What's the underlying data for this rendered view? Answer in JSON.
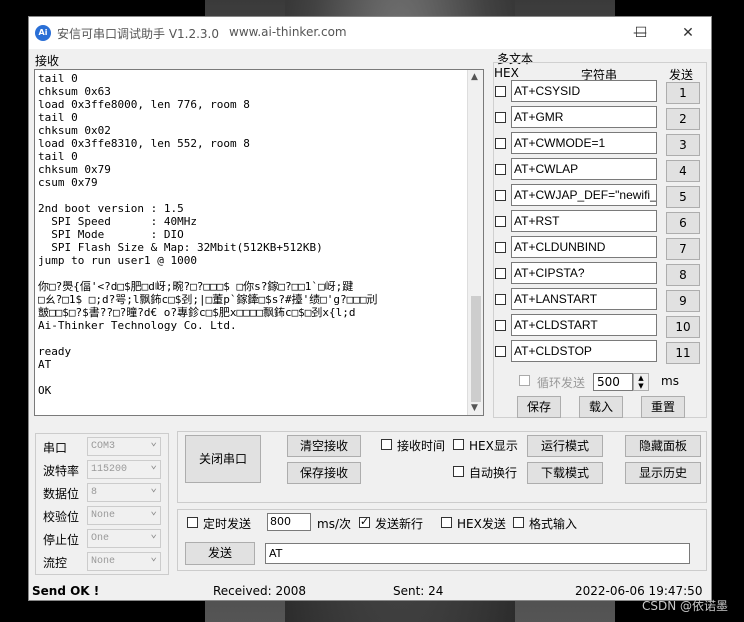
{
  "window": {
    "title": "安信可串口调试助手 V1.2.3.0",
    "site": "www.ai-thinker.com",
    "icon_text": "Ai",
    "buttons": {
      "minimize": "—",
      "maximize": "☐",
      "close": "✕"
    }
  },
  "receive": {
    "label": "接收",
    "text": "tail 0\nchksum 0x63\nload 0x3ffe8000, len 776, room 8\ntail 0\nchksum 0x02\nload 0x3ffe8310, len 552, room 8\ntail 0\nchksum 0x79\ncsum 0x79\n\n2nd boot version : 1.5\n  SPI Speed      : 40MHz\n  SPI Mode       : DIO\n  SPI Flash Size & Map: 32Mbit(512KB+512KB)\njump to run user1 @ 1000\n\n你□?爂{偪'<?d□$肥□d岈;畹?□?□□□$ □你s?鎵□?□□1`□岈;踺\n□ㄠ?□1$ □;d?咢;l飘鈽c□$刭;|□董p`鎵鏲□$s?#擡'绩□'g?□□□刓\n皽□□$□?$書??□?曈?d€ o?專鉁c□$肥x□□□□飘鈽c□$□刭x{l;d\nAi-Thinker Technology Co. Ltd.\n\nready\nAT\n\nOK"
  },
  "multi": {
    "title": "多文本",
    "col_hex": "HEX",
    "col_str": "字符串",
    "col_send": "发送",
    "rows": [
      {
        "cmd": "AT+CSYSID",
        "num": "1"
      },
      {
        "cmd": "AT+GMR",
        "num": "2"
      },
      {
        "cmd": "AT+CWMODE=1",
        "num": "3"
      },
      {
        "cmd": "AT+CWLAP",
        "num": "4"
      },
      {
        "cmd": "AT+CWJAP_DEF=\"newifi_",
        "num": "5"
      },
      {
        "cmd": "AT+RST",
        "num": "6"
      },
      {
        "cmd": "AT+CLDUNBIND",
        "num": "7"
      },
      {
        "cmd": "AT+CIPSTA?",
        "num": "8"
      },
      {
        "cmd": "AT+LANSTART",
        "num": "9"
      },
      {
        "cmd": "AT+CLDSTART",
        "num": "10"
      },
      {
        "cmd": "AT+CLDSTOP",
        "num": "11"
      }
    ],
    "loop_label": "循环发送",
    "loop_value": "500",
    "loop_unit": "ms",
    "save": "保存",
    "load": "载入",
    "reset": "重置"
  },
  "serial": {
    "port_label": "串口",
    "port_value": "COM3",
    "baud_label": "波特率",
    "baud_value": "115200",
    "data_label": "数据位",
    "data_value": "8",
    "parity_label": "校验位",
    "parity_value": "None",
    "stop_label": "停止位",
    "stop_value": "One",
    "flow_label": "流控",
    "flow_value": "None"
  },
  "controls": {
    "close_port": "关闭串口",
    "clear_recv": "清空接收",
    "save_recv": "保存接收",
    "recv_time": "接收时间",
    "hex_show": "HEX显示",
    "auto_wrap": "自动换行",
    "run_mode": "运行模式",
    "download_mode": "下载模式",
    "hide_panel": "隐藏面板",
    "show_history": "显示历史"
  },
  "send": {
    "timed_send": "定时发送",
    "timer_value": "800",
    "timer_unit": "ms/次",
    "newline": "发送新行",
    "hex_send": "HEX发送",
    "format_input": "格式输入",
    "send_button": "发送",
    "input_value": "AT"
  },
  "status": {
    "send_ok": "Send OK !",
    "received": "Received: 2008",
    "sent": "Sent: 24",
    "datetime": "2022-06-06 19:47:50"
  },
  "watermark": "CSDN @依诺墨"
}
